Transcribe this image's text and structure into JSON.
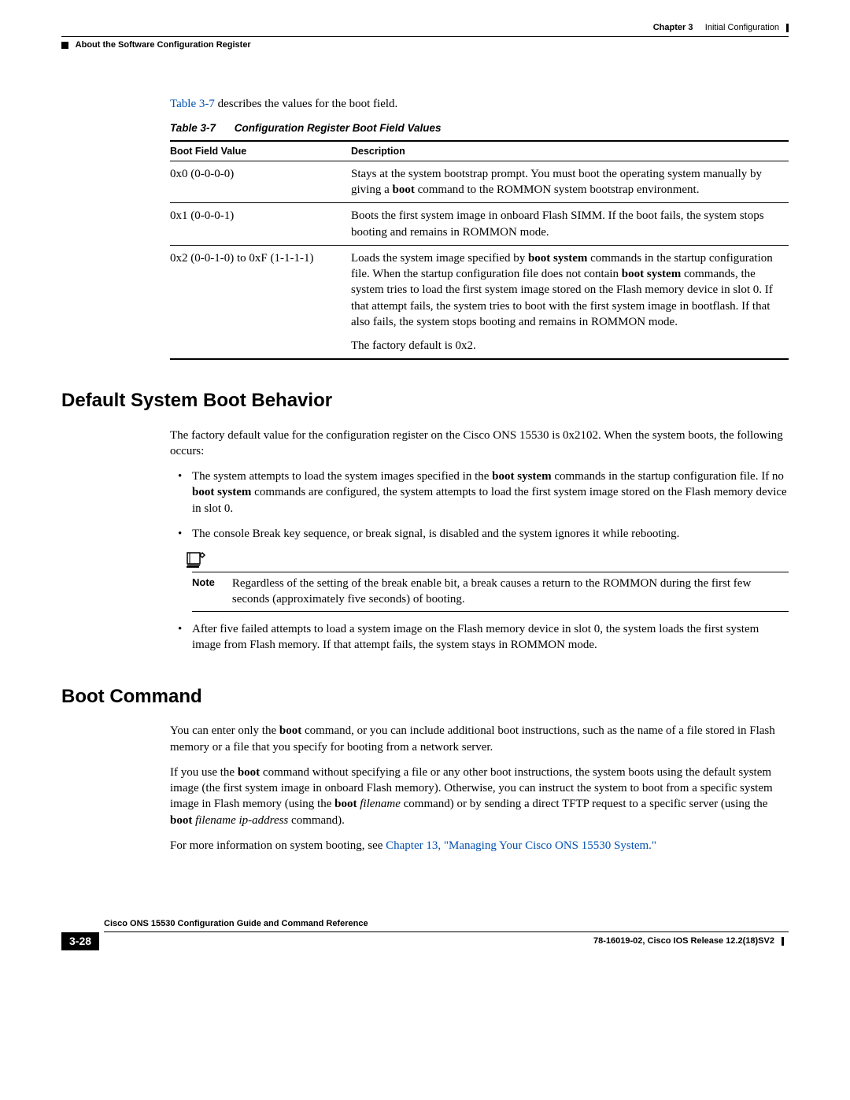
{
  "header": {
    "chapter_label": "Chapter 3",
    "chapter_title": "Initial Configuration",
    "section_title": "About the Software Configuration Register"
  },
  "intro": {
    "link": "Table 3-7",
    "text": " describes the values for the boot field."
  },
  "table": {
    "caption_label": "Table 3-7",
    "caption_title": "Configuration Register Boot Field Values",
    "col1": "Boot Field Value",
    "col2": "Description",
    "rows": [
      {
        "value": "0x0 (0-0-0-0)",
        "desc_pre": "Stays at the system bootstrap prompt. You must boot the operating system manually by giving a ",
        "desc_bold": "boot",
        "desc_post": " command to the ROMMON system bootstrap environment."
      },
      {
        "value": "0x1 (0-0-0-1)",
        "desc": "Boots the first system image in onboard Flash SIMM. If the boot fails, the system stops booting and remains in ROMMON mode."
      },
      {
        "value": "0x2 (0-0-1-0) to 0xF (1-1-1-1)",
        "desc_p1a": "Loads the system image specified by ",
        "desc_p1_bold1": "boot system",
        "desc_p1b": " commands in the startup configuration file. When the startup configuration file does not contain ",
        "desc_p1_bold2": "boot system",
        "desc_p1c": " commands, the system tries to load the first system image stored on the Flash memory device in slot 0. If that attempt fails, the system tries to boot with the first system image in bootflash. If that also fails, the system stops booting and remains in ROMMON mode.",
        "desc_p2": "The factory default is 0x2."
      }
    ]
  },
  "sections": {
    "default_boot": {
      "heading": "Default System Boot Behavior",
      "intro": "The factory default value for the configuration register on the Cisco ONS 15530 is 0x2102. When the system boots, the following occurs:",
      "bullets": [
        {
          "pre": "The system attempts to load the system images specified in the ",
          "bold1": "boot system",
          "mid": " commands in the startup configuration file. If no ",
          "bold2": "boot system",
          "post": " commands are configured, the system attempts to load the first system image stored on the Flash memory device in slot 0."
        },
        {
          "text": "The console Break key sequence, or break signal, is disabled and the system ignores it while rebooting."
        },
        {
          "text": "After five failed attempts to load a system image on the Flash memory device in slot 0, the system loads the first system image from Flash memory. If that attempt fails, the system stays in ROMMON mode."
        }
      ],
      "note": {
        "label": "Note",
        "text": "Regardless of the setting of the break enable bit, a break causes a return to the ROMMON during the first few seconds (approximately five seconds) of booting."
      }
    },
    "boot_command": {
      "heading": "Boot Command",
      "p1_pre": "You can enter only the ",
      "p1_bold": "boot",
      "p1_post": " command, or you can include additional boot instructions, such as the name of a file stored in Flash memory or a file that you specify for booting from a network server.",
      "p2_pre": "If you use the ",
      "p2_bold1": "boot",
      "p2_mid1": " command without specifying a file or any other boot instructions, the system boots using the default system image (the first system image in onboard Flash memory). Otherwise, you can instruct the system to boot from a specific system image in Flash memory (using the ",
      "p2_bold2": "boot",
      "p2_ital1": " filename",
      "p2_mid2": " command) or by sending a direct TFTP request to a specific server (using the ",
      "p2_bold3": "boot",
      "p2_ital2": " filename ip-address",
      "p2_post": " command).",
      "p3_pre": "For more information on system booting, see ",
      "p3_link": "Chapter 13, \"Managing Your Cisco ONS 15530 System.\""
    }
  },
  "footer": {
    "doc_title": "Cisco ONS 15530 Configuration Guide and Command Reference",
    "page": "3-28",
    "right": "78-16019-02, Cisco IOS Release 12.2(18)SV2"
  }
}
